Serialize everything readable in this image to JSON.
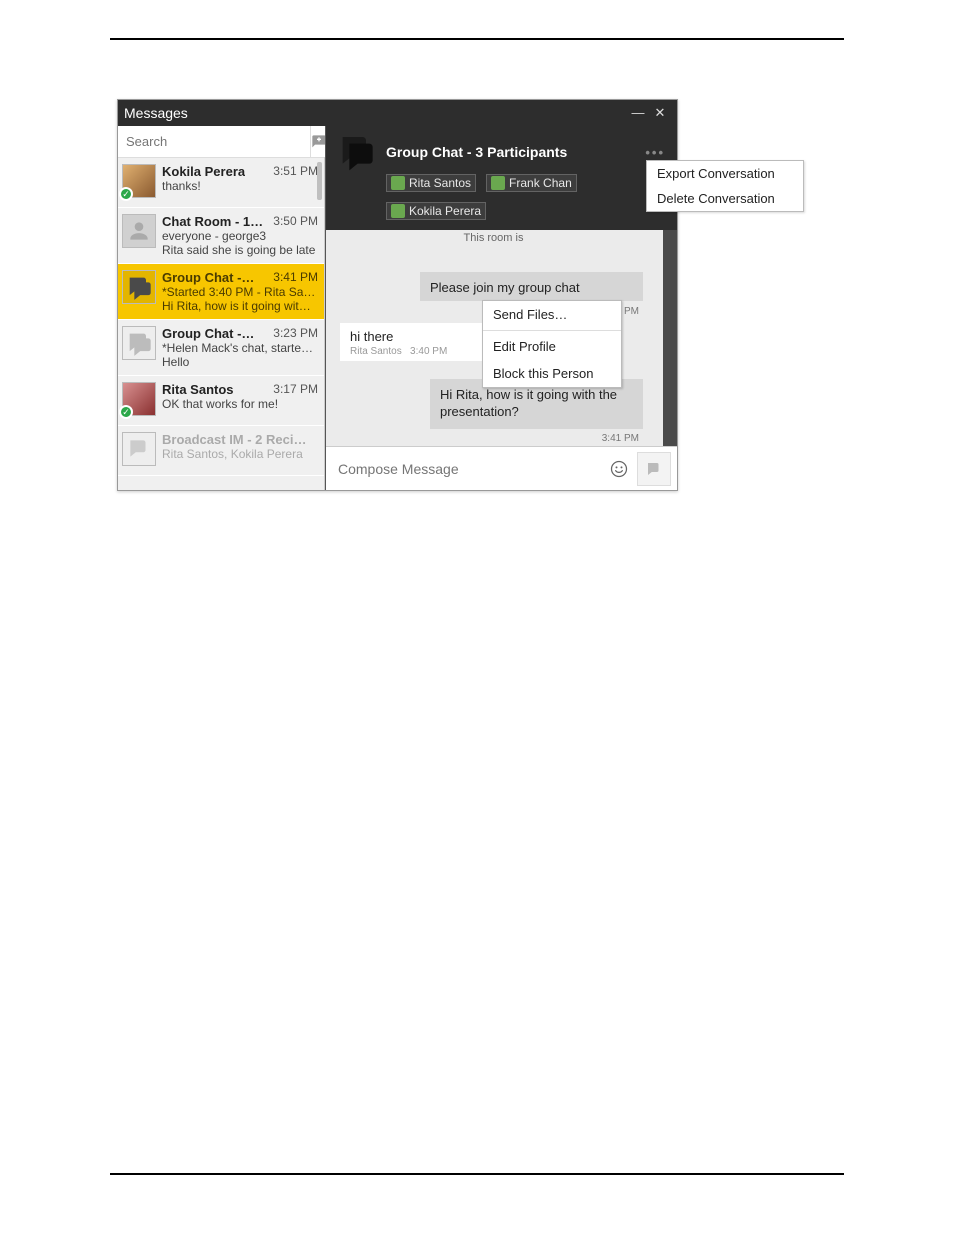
{
  "window": {
    "title": "Messages",
    "minimize": "—",
    "close": "✕"
  },
  "search": {
    "placeholder": "Search"
  },
  "conversations": [
    {
      "name": "Kokila Perera",
      "time": "3:51 PM",
      "line2": "thanks!",
      "line3": ""
    },
    {
      "name": "Chat Room - 1…",
      "time": "3:50 PM",
      "line2": "everyone - george3",
      "line3": "Rita said she is going be late"
    },
    {
      "name": "Group Chat -…",
      "time": "3:41 PM",
      "line2": "*Started 3:40 PM - Rita San…",
      "line3": "Hi Rita, how is it going wit…"
    },
    {
      "name": "Group Chat -…",
      "time": "3:23 PM",
      "line2": "*Helen Mack's chat, starte…",
      "line3": "Hello"
    },
    {
      "name": "Rita Santos",
      "time": "3:17 PM",
      "line2": "OK that works for me!",
      "line3": ""
    },
    {
      "name": "Broadcast IM - 2 Reci…",
      "time": "",
      "line2": "Rita Santos, Kokila Perera",
      "line3": ""
    }
  ],
  "chat_header": {
    "title": "Group Chat - 3 Participants",
    "participants": [
      "Rita Santos",
      "Frank Chan",
      "Kokila Perera"
    ]
  },
  "context_menu": {
    "send_files": "Send Files…",
    "edit_profile": "Edit Profile",
    "block_person": "Block this Person"
  },
  "more_menu": {
    "export": "Export Conversation",
    "delete": "Delete Conversation"
  },
  "chat": {
    "system_msg": "This room is",
    "bubble1_text": "Please join my group chat",
    "bubble1_time": "3:40 PM",
    "bubble2_text": "hi there",
    "bubble2_sender": "Rita Santos",
    "bubble2_time": "3:40 PM",
    "bubble3_text": "Hi Rita, how is it going with the presentation?",
    "bubble3_time": "3:41 PM"
  },
  "compose": {
    "placeholder": "Compose Message"
  }
}
